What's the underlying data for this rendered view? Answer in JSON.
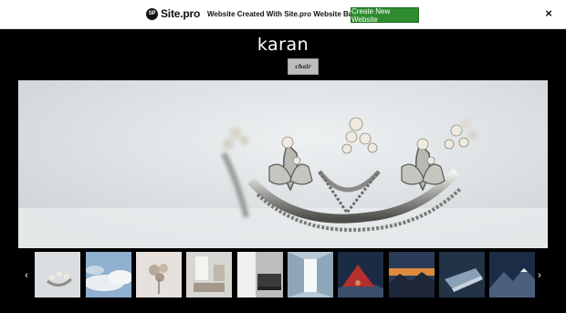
{
  "banner": {
    "logo_mark": "SP",
    "logo_text": "Site.pro",
    "tagline": "Website Created With Site.pro Website Builder",
    "cta_label": "Create New Website",
    "close_label": "×"
  },
  "header": {
    "title": "karan",
    "nav_button_label": "chair"
  },
  "gallery": {
    "prev_label": "‹",
    "next_label": "›",
    "thumbnails": [
      {
        "name": "thumb-crown",
        "active": true
      },
      {
        "name": "thumb-clouds",
        "active": false
      },
      {
        "name": "thumb-flowers",
        "active": false
      },
      {
        "name": "thumb-room",
        "active": false
      },
      {
        "name": "thumb-living-room",
        "active": false
      },
      {
        "name": "thumb-corridor",
        "active": false
      },
      {
        "name": "thumb-tent",
        "active": false
      },
      {
        "name": "thumb-sunset-mountains",
        "active": false
      },
      {
        "name": "thumb-laptop",
        "active": false
      },
      {
        "name": "thumb-mountain-peak",
        "active": false
      }
    ]
  },
  "colors": {
    "background": "#000000",
    "cta_green": "#2e8b2e",
    "nav_button": "#bdbdbd"
  }
}
